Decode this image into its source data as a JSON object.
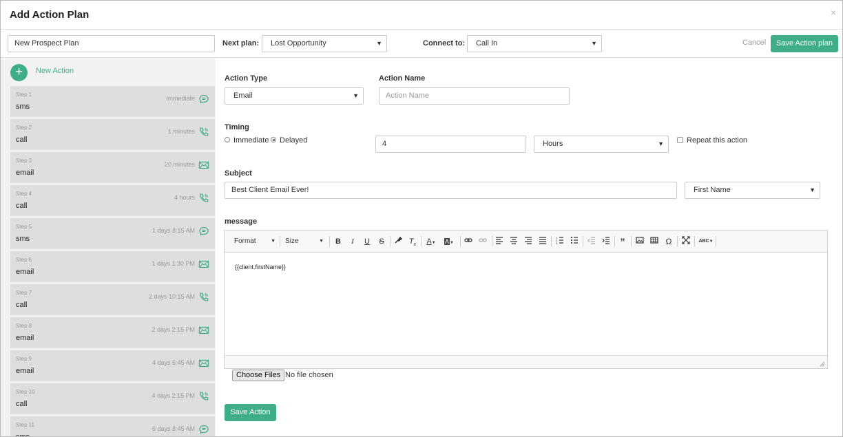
{
  "modal": {
    "title": "Add Action Plan",
    "close": "×"
  },
  "topbar": {
    "plan_name": "New Prospect Plan",
    "next_plan_label": "Next plan:",
    "next_plan_value": "Lost Opportunity",
    "connect_label": "Connect to:",
    "connect_value": "Call In",
    "cancel": "Cancel",
    "save": "Save Action plan"
  },
  "sidebar": {
    "new_action": "New Action",
    "steps": [
      {
        "num": "Step 1",
        "type": "sms",
        "when": "Immediate",
        "icon": "sms-icon"
      },
      {
        "num": "Step 2",
        "type": "call",
        "when": "1 minutes",
        "icon": "phone-icon"
      },
      {
        "num": "Step 3",
        "type": "email",
        "when": "20 minutes",
        "icon": "email-icon"
      },
      {
        "num": "Step 4",
        "type": "call",
        "when": "4 hours",
        "icon": "phone-icon"
      },
      {
        "num": "Step 5",
        "type": "sms",
        "when": "1 days 8:15 AM",
        "icon": "sms-icon"
      },
      {
        "num": "Step 6",
        "type": "email",
        "when": "1 days 1:30 PM",
        "icon": "email-icon"
      },
      {
        "num": "Step 7",
        "type": "call",
        "when": "2 days 10:15 AM",
        "icon": "phone-icon"
      },
      {
        "num": "Step 8",
        "type": "email",
        "when": "2 days 2:15 PM",
        "icon": "email-icon"
      },
      {
        "num": "Step 9",
        "type": "email",
        "when": "4 days 6:45 AM",
        "icon": "email-icon"
      },
      {
        "num": "Step 10",
        "type": "call",
        "when": "4 days 2:15 PM",
        "icon": "phone-icon"
      },
      {
        "num": "Step 11",
        "type": "sms",
        "when": "6 days 8:45 AM",
        "icon": "sms-icon"
      }
    ]
  },
  "form": {
    "action_type_label": "Action Type",
    "action_type_value": "Email",
    "action_name_label": "Action Name",
    "action_name_placeholder": "Action Name",
    "timing_label": "Timing",
    "immediate_label": "Immediate",
    "delayed_label": "Delayed",
    "delay_amount": "4",
    "delay_unit": "Hours",
    "repeat_label": "Repeat this action",
    "subject_label": "Subject",
    "subject_value": "Best Client Email Ever!",
    "merge_field": "First Name",
    "message_label": "message",
    "editor": {
      "format": "Format",
      "size": "Size",
      "content": "{{client.firstName}}"
    },
    "choose_files": "Choose Files",
    "no_file": "No file chosen",
    "save_action": "Save Action"
  },
  "colors": {
    "accent": "#3fae86",
    "sidebar_bg": "#f2f2f2",
    "step_bg": "#dedede"
  }
}
